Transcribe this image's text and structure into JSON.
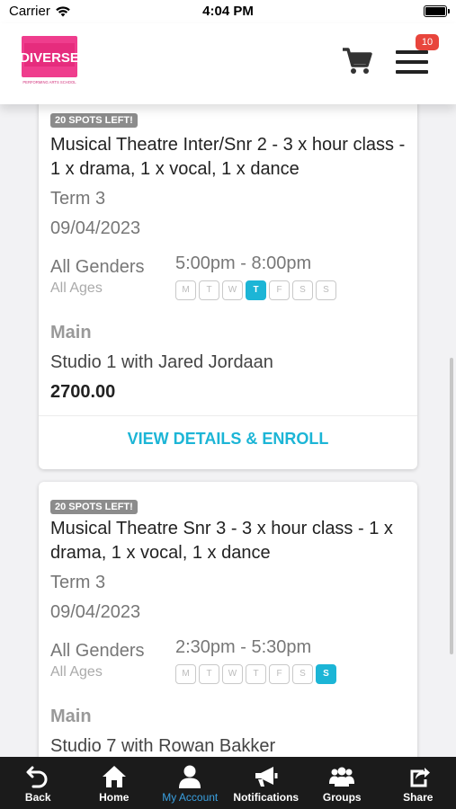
{
  "status_bar": {
    "carrier": "Carrier",
    "time": "4:04 PM"
  },
  "header": {
    "logo_text": "DIVERSE",
    "logo_subtext": "PERFORMING ARTS SCHOOL",
    "cart_icon": "cart-icon",
    "menu_icon": "hamburger-menu-icon",
    "badge_count": "10",
    "badge_color": "#e8453c"
  },
  "accent_color": "#1cb5d6",
  "day_letters": [
    "M",
    "T",
    "W",
    "T",
    "F",
    "S",
    "S"
  ],
  "classes": [
    {
      "spots": "20 SPOTS LEFT!",
      "title": "Musical Theatre Inter/Snr 2 - 3 x hour class - 1 x drama, 1 x vocal, 1 x dance",
      "term": "Term 3",
      "date": "09/04/2023",
      "genders": "All Genders",
      "ages": "All Ages",
      "time": "5:00pm - 8:00pm",
      "active_day": "Thursday",
      "location": "Main",
      "studio": "Studio 1 with Jared Jordaan",
      "price": "2700.00",
      "action": "VIEW DETAILS & ENROLL"
    },
    {
      "spots": "20 SPOTS LEFT!",
      "title": "Musical Theatre Snr 3 - 3 x hour class - 1 x drama, 1 x vocal, 1 x dance",
      "term": "Term 3",
      "date": "09/04/2023",
      "genders": "All Genders",
      "ages": "All Ages",
      "time": "2:30pm - 5:30pm",
      "active_day": "Sunday",
      "location": "Main",
      "studio": "Studio 7 with Rowan Bakker"
    }
  ],
  "tabbar": {
    "items": [
      {
        "label": "Back",
        "icon": "back-icon"
      },
      {
        "label": "Home",
        "icon": "home-icon"
      },
      {
        "label": "My Account",
        "icon": "user-icon",
        "active": true
      },
      {
        "label": "Notifications",
        "icon": "megaphone-icon"
      },
      {
        "label": "Groups",
        "icon": "groups-icon"
      },
      {
        "label": "Share",
        "icon": "share-icon"
      }
    ]
  }
}
